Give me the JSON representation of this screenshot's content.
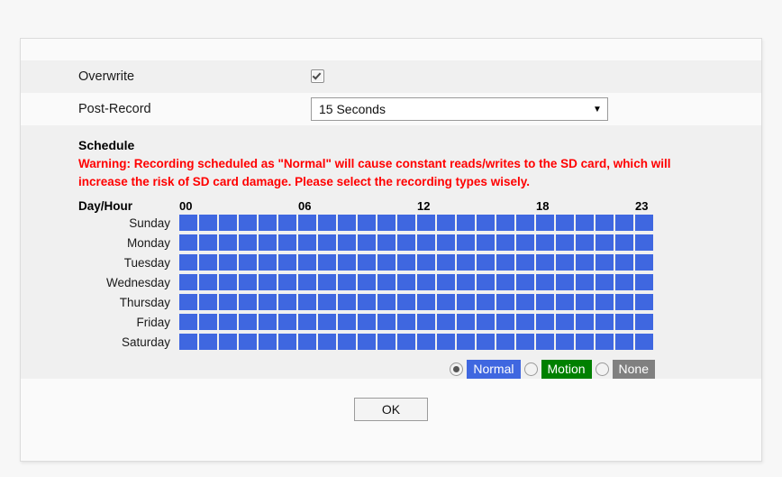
{
  "settings": {
    "overwrite": {
      "label": "Overwrite",
      "checked": true
    },
    "post_record": {
      "label": "Post-Record",
      "value": "15 Seconds",
      "arrow": "▼"
    }
  },
  "schedule": {
    "title": "Schedule",
    "warning": "Warning:  Recording scheduled as \"Normal\" will cause constant reads/writes to the SD card, which will increase the risk of SD card damage. Please select the recording types wisely.",
    "day_hour_label": "Day/Hour",
    "hour_ticks": [
      "00",
      "06",
      "12",
      "18",
      "23"
    ],
    "days": [
      "Sunday",
      "Monday",
      "Tuesday",
      "Wednesday",
      "Thursday",
      "Friday",
      "Saturday"
    ],
    "grid": [
      [
        "normal",
        "normal",
        "normal",
        "normal",
        "normal",
        "normal",
        "normal",
        "normal",
        "normal",
        "normal",
        "normal",
        "normal",
        "normal",
        "normal",
        "normal",
        "normal",
        "normal",
        "normal",
        "normal",
        "normal",
        "normal",
        "normal",
        "normal",
        "normal"
      ],
      [
        "normal",
        "normal",
        "normal",
        "normal",
        "normal",
        "normal",
        "normal",
        "normal",
        "normal",
        "normal",
        "normal",
        "normal",
        "normal",
        "normal",
        "normal",
        "normal",
        "normal",
        "normal",
        "normal",
        "normal",
        "normal",
        "normal",
        "normal",
        "normal"
      ],
      [
        "normal",
        "normal",
        "normal",
        "normal",
        "normal",
        "normal",
        "normal",
        "normal",
        "normal",
        "normal",
        "normal",
        "normal",
        "normal",
        "normal",
        "normal",
        "normal",
        "normal",
        "normal",
        "normal",
        "normal",
        "normal",
        "normal",
        "normal",
        "normal"
      ],
      [
        "normal",
        "normal",
        "normal",
        "normal",
        "normal",
        "normal",
        "normal",
        "normal",
        "normal",
        "normal",
        "normal",
        "normal",
        "normal",
        "normal",
        "normal",
        "normal",
        "normal",
        "normal",
        "normal",
        "normal",
        "normal",
        "normal",
        "normal",
        "normal"
      ],
      [
        "normal",
        "normal",
        "normal",
        "normal",
        "normal",
        "normal",
        "normal",
        "normal",
        "normal",
        "normal",
        "normal",
        "normal",
        "normal",
        "normal",
        "normal",
        "normal",
        "normal",
        "normal",
        "normal",
        "normal",
        "normal",
        "normal",
        "normal",
        "normal"
      ],
      [
        "normal",
        "normal",
        "normal",
        "normal",
        "normal",
        "normal",
        "normal",
        "normal",
        "normal",
        "normal",
        "normal",
        "normal",
        "normal",
        "normal",
        "normal",
        "normal",
        "normal",
        "normal",
        "normal",
        "normal",
        "normal",
        "normal",
        "normal",
        "normal"
      ],
      [
        "normal",
        "normal",
        "normal",
        "normal",
        "normal",
        "normal",
        "normal",
        "normal",
        "normal",
        "normal",
        "normal",
        "normal",
        "normal",
        "normal",
        "normal",
        "normal",
        "normal",
        "normal",
        "normal",
        "normal",
        "normal",
        "normal",
        "normal",
        "normal"
      ]
    ],
    "legend": [
      {
        "label": "Normal",
        "type": "normal",
        "selected": true
      },
      {
        "label": "Motion",
        "type": "motion",
        "selected": false
      },
      {
        "label": "None",
        "type": "none",
        "selected": false
      }
    ]
  },
  "footer": {
    "ok_label": "OK"
  },
  "colors": {
    "normal": "#3f67e0",
    "motion": "#008000",
    "none": "#808080",
    "warning": "#ff0000"
  }
}
